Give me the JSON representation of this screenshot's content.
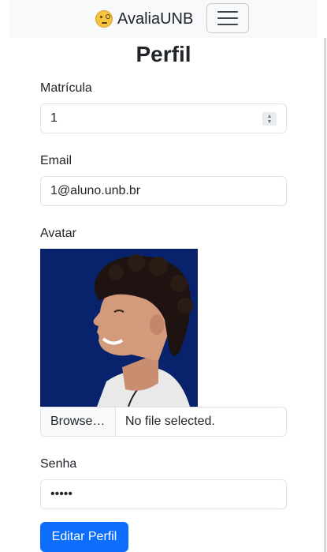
{
  "navbar": {
    "brand": "AvaliaUNB",
    "brand_icon": "monocle-face-icon",
    "toggler_icon": "hamburger-icon"
  },
  "page": {
    "title": "Perfil"
  },
  "form": {
    "matricula": {
      "label": "Matrícula",
      "value": "1"
    },
    "email": {
      "label": "Email",
      "value": "1@aluno.unb.br"
    },
    "avatar": {
      "label": "Avatar",
      "browse_label": "Browse…",
      "file_status": "No file selected."
    },
    "senha": {
      "label": "Senha",
      "value": "•••••"
    },
    "submit_label": "Editar Perfil"
  },
  "colors": {
    "primary": "#0d6efd",
    "navbar_bg": "#f8f9fa",
    "avatar_bg": "#08236b"
  }
}
